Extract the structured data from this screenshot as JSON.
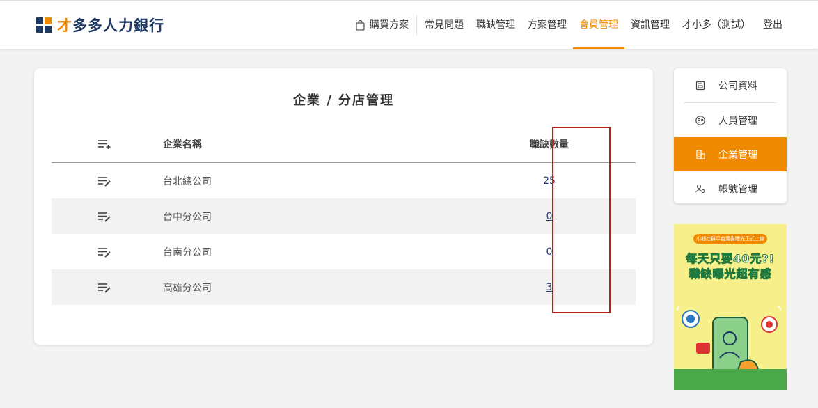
{
  "header": {
    "logo_accent": "才",
    "logo_text": "多多人力銀行",
    "nav": [
      {
        "label": "購買方案"
      },
      {
        "label": "常見問題"
      },
      {
        "label": "職缺管理"
      },
      {
        "label": "方案管理"
      },
      {
        "label": "會員管理"
      },
      {
        "label": "資訊管理"
      },
      {
        "label": "才小多（測試）"
      },
      {
        "label": "登出"
      }
    ]
  },
  "main": {
    "title": "企業 / 分店管理",
    "columns": {
      "name": "企業名稱",
      "count": "職缺數量"
    },
    "rows": [
      {
        "name": "台北總公司",
        "count": "25"
      },
      {
        "name": "台中分公司",
        "count": "0"
      },
      {
        "name": "台南分公司",
        "count": "0"
      },
      {
        "name": "高雄分公司",
        "count": "3"
      }
    ]
  },
  "side": {
    "items": [
      {
        "label": "公司資料",
        "icon": "id-card-icon"
      },
      {
        "label": "人員管理",
        "icon": "people-icon"
      },
      {
        "label": "企業管理",
        "icon": "building-icon"
      },
      {
        "label": "帳號管理",
        "icon": "user-gear-icon"
      }
    ]
  },
  "ad": {
    "tag": "小額社群平台廣告曝光正式上線",
    "line1": "每天只要40元?!",
    "line2": "職缺曝光超有感"
  },
  "colors": {
    "accent": "#f08a00",
    "brand": "#1e3a64",
    "highlight": "#b22222"
  }
}
